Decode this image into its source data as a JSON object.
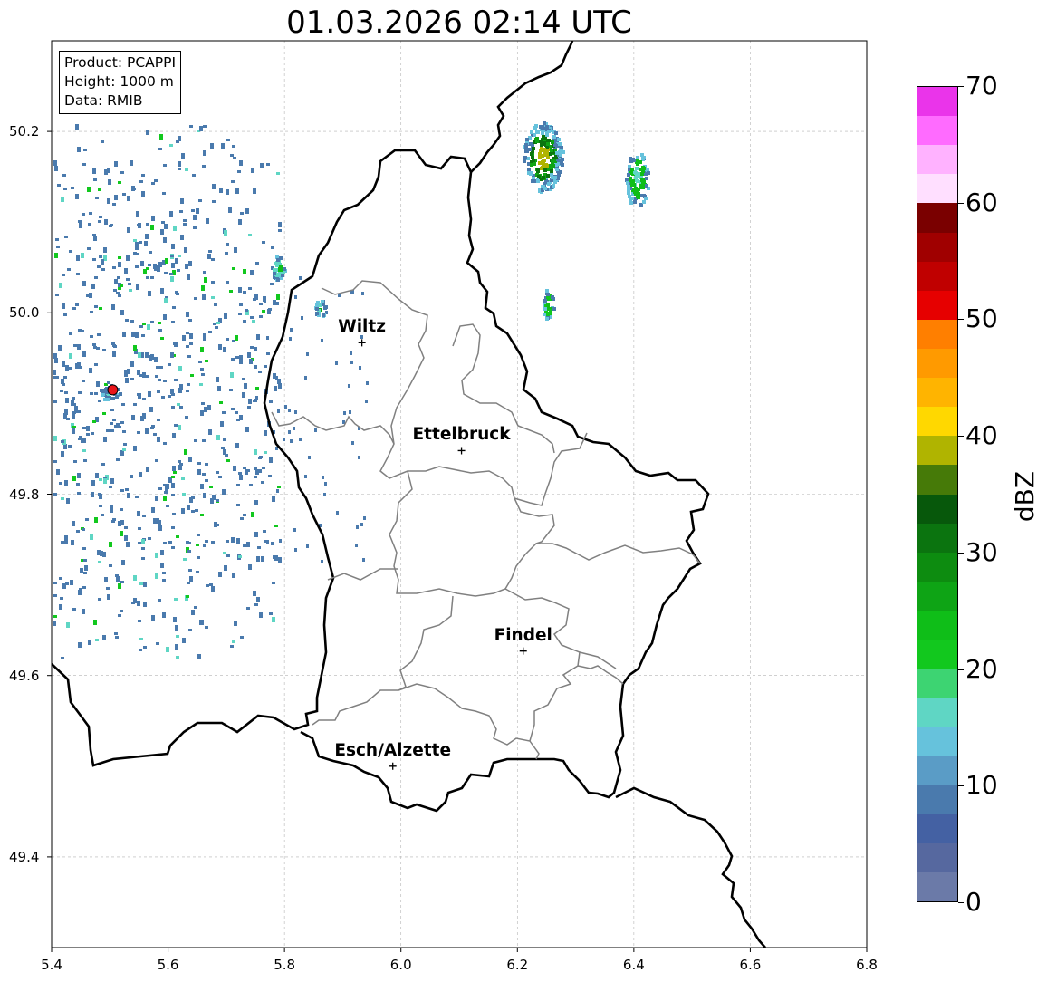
{
  "title": "01.03.2026 02:14 UTC",
  "info": {
    "product": "Product: PCAPPI",
    "height": "Height: 1000 m",
    "data": "Data: RMIB"
  },
  "axes": {
    "x_ticks": [
      "5.4",
      "5.6",
      "5.8",
      "6.0",
      "6.2",
      "6.4",
      "6.6",
      "6.8"
    ],
    "y_ticks": [
      "50.2",
      "50.0",
      "49.8",
      "49.6",
      "49.4"
    ],
    "lon_range": [
      5.4,
      6.8
    ],
    "lat_range": [
      49.3,
      50.3
    ],
    "grid": true
  },
  "cities": [
    {
      "name": "Wiltz",
      "lon": 5.933,
      "lat": 49.967
    },
    {
      "name": "Ettelbruck",
      "lon": 6.104,
      "lat": 49.848
    },
    {
      "name": "Findel",
      "lon": 6.21,
      "lat": 49.627
    },
    {
      "name": "Esch/Alzette",
      "lon": 5.986,
      "lat": 49.5
    }
  ],
  "radar_site": {
    "lon": 5.505,
    "lat": 49.915,
    "color": "#e8141a"
  },
  "colorbar": {
    "label": "dBZ",
    "ticks": [
      "0",
      "10",
      "20",
      "30",
      "40",
      "50",
      "60",
      "70"
    ],
    "min": 0,
    "max": 70,
    "colors": [
      "#6b7aa8",
      "#56689f",
      "#4461a3",
      "#4a7aad",
      "#5a9cc6",
      "#66c2dc",
      "#5fd6c4",
      "#3dd472",
      "#12c81e",
      "#0fbe18",
      "#0ea415",
      "#0d8c10",
      "#0b740f",
      "#07580b",
      "#467a08",
      "#b0b400",
      "#ffd800",
      "#ffb400",
      "#ff9a00",
      "#ff7f00",
      "#e60000",
      "#c00000",
      "#a00000",
      "#7a0000",
      "#ffdfff",
      "#ffb2ff",
      "#ff6bff",
      "#ea34ea"
    ]
  },
  "colors": {
    "country_border": "#000000",
    "canton_border": "#808080",
    "grid": "#b4b4b4"
  }
}
